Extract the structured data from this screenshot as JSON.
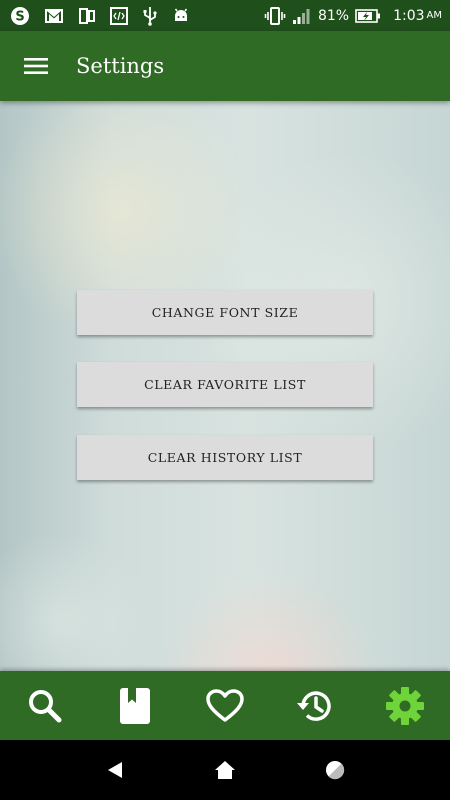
{
  "status_bar": {
    "battery_percent": "81%",
    "time": "1:03",
    "ampm": "AM",
    "left_icons": [
      "skype-icon",
      "gmail-icon",
      "multi-window-icon",
      "code-icon",
      "usb-icon",
      "android-icon"
    ],
    "right_icons": [
      "vibrate-icon",
      "signal-icon",
      "battery-charging-icon"
    ]
  },
  "app_bar": {
    "title": "Settings"
  },
  "buttons": {
    "change_font_size": "CHANGE FONT SIZE",
    "clear_favorite_list": "CLEAR FAVORITE LIST",
    "clear_history_list": "CLEAR HISTORY LIST"
  },
  "tabs": [
    {
      "name": "search",
      "icon": "search-icon",
      "active": false
    },
    {
      "name": "bookmarks",
      "icon": "bookmark-book-icon",
      "active": false
    },
    {
      "name": "favorites",
      "icon": "heart-icon",
      "active": false
    },
    {
      "name": "history",
      "icon": "history-icon",
      "active": false
    },
    {
      "name": "settings",
      "icon": "gear-icon",
      "active": true
    }
  ],
  "colors": {
    "status_bar": "#1f4f1a",
    "app_bar": "#2f6b24",
    "active_tab": "#6ed43a",
    "button_bg": "#dcdcdc"
  }
}
